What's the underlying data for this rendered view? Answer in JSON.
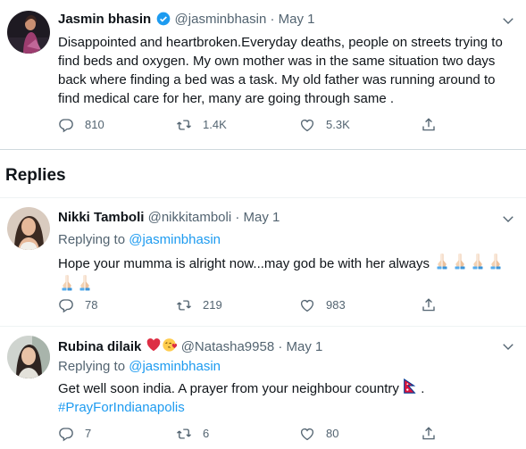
{
  "main_tweet": {
    "name": "Jasmin bhasin",
    "handle": "@jasminbhasin",
    "dot": "·",
    "date": "May 1",
    "text": "Disappointed and heartbroken.Everyday deaths, people on streets trying to find beds and oxygen. My own mother was in the same situation two days back where finding a bed was a task. My old father was running around to find medical care for her, many are going through same .",
    "replies": "810",
    "retweets": "1.4K",
    "likes": "5.3K"
  },
  "section": {
    "title": "Replies"
  },
  "replies": [
    {
      "name": "Nikki Tamboli",
      "handle": "@nikkitamboli",
      "dot": "·",
      "date": "May 1",
      "replying_label": "Replying to",
      "replying_handle": "@jasminbhasin",
      "text": "Hope your mumma is alright now...may god be with her always",
      "emoji_count": 6,
      "replies": "78",
      "retweets": "219",
      "likes": "983"
    },
    {
      "name": "Rubina dilaik",
      "handle": "@Natasha9958",
      "dot": "·",
      "date": "May 1",
      "replying_label": "Replying to",
      "replying_handle": "@jasminbhasin",
      "text": "Get well soon india. A prayer from your neighbour country",
      "text_end": " .",
      "hashtag": "#PrayForIndianapolis",
      "replies": "7",
      "retweets": "6",
      "likes": "80"
    }
  ],
  "colors": {
    "accent": "#1d9bf0",
    "secondary_text": "#536471",
    "heart": "#e0245e"
  },
  "icons": [
    "verified-badge-icon",
    "more-icon",
    "reply-icon",
    "retweet-icon",
    "like-icon",
    "share-icon",
    "praying-hands-emoji",
    "heart-emoji",
    "kiss-emoji",
    "nepal-flag-emoji"
  ]
}
